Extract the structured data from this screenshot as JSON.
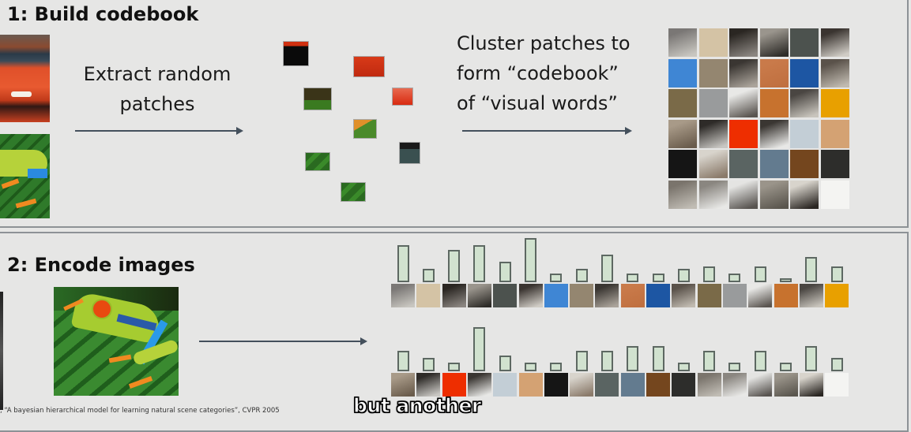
{
  "step1": {
    "title": "1: Build codebook",
    "extract_caption": [
      "Extract random",
      "patches"
    ],
    "cluster_caption": [
      "Cluster patches to",
      "form “codebook”",
      "of “visual words”"
    ]
  },
  "step2": {
    "title": "2: Encode images"
  },
  "codebook_colors": [
    [
      "#7a7775",
      "#c8c6c0"
    ],
    [
      "#d4c3a5",
      "#d4c3a5"
    ],
    [
      "#2a2622",
      "#8a8580"
    ],
    [
      "#9a958d",
      "#2e2c28"
    ],
    [
      "#4c524e",
      "#4c524e"
    ],
    [
      "#3a3430",
      "#d0ccc5"
    ],
    [
      "#3f86d4",
      "#3f86d4"
    ],
    [
      "#948670",
      "#948670"
    ],
    [
      "#3a3632",
      "#aaa39a"
    ],
    [
      "#c97a4a",
      "#c07040"
    ],
    [
      "#1d56a3",
      "#1d56a3"
    ],
    [
      "#5a524a",
      "#c0bab0"
    ],
    [
      "#7a6a48",
      "#7a6a48"
    ],
    [
      "#999b9c",
      "#999b9c"
    ],
    [
      "#e8e8e6",
      "#5a5550"
    ],
    [
      "#c7722e",
      "#c7722e"
    ],
    [
      "#4a4642",
      "#c8c4bc"
    ],
    [
      "#e8a000",
      "#e8a000"
    ],
    [
      "#a89a88",
      "#6a5c4c"
    ],
    [
      "#2e2b28",
      "#c8c6c2"
    ],
    [
      "#ee2e00",
      "#ee2e00"
    ],
    [
      "#3a3632",
      "#e8e8e6"
    ],
    [
      "#c3ced6",
      "#c3ced6"
    ],
    [
      "#d4a273",
      "#d4a273"
    ],
    [
      "#151515",
      "#151515"
    ],
    [
      "#d8d4cc",
      "#8a7a6a"
    ],
    [
      "#5a6462",
      "#5a6462"
    ],
    [
      "#637b8f",
      "#637b8f"
    ],
    [
      "#74461e",
      "#74461e"
    ],
    [
      "#2d2d2b",
      "#2d2d2b"
    ],
    [
      "#7a746c",
      "#c0bcb4"
    ],
    [
      "#8a8680",
      "#e8e8e6"
    ],
    [
      "#e4e4e2",
      "#585450"
    ],
    [
      "#9a948a",
      "#5a564e"
    ],
    [
      "#d8d4cc",
      "#2a2622"
    ],
    [
      "#f4f4f2",
      "#f4f4f2"
    ]
  ],
  "histograms": [
    {
      "words": [
        0,
        1,
        2,
        3,
        4,
        5,
        6,
        7,
        8,
        9,
        10,
        11,
        12,
        13,
        14,
        15,
        16,
        17
      ],
      "counts": [
        15,
        5,
        13,
        15,
        8,
        18,
        3,
        5,
        11,
        3,
        3,
        5,
        6,
        3,
        6,
        1,
        10,
        6
      ]
    },
    {
      "words": [
        18,
        19,
        20,
        21,
        22,
        23,
        24,
        25,
        26,
        27,
        28,
        29,
        30,
        31,
        32,
        33,
        34,
        35
      ],
      "counts": [
        8,
        5,
        3,
        18,
        6,
        3,
        3,
        8,
        8,
        10,
        10,
        3,
        8,
        3,
        8,
        3,
        10,
        5
      ]
    }
  ],
  "bar_color": "#d1e2cf",
  "citation": ", “A bayesian hierarchical model for learning natural scene categories”, CVPR 2005",
  "subtitle": "but another"
}
